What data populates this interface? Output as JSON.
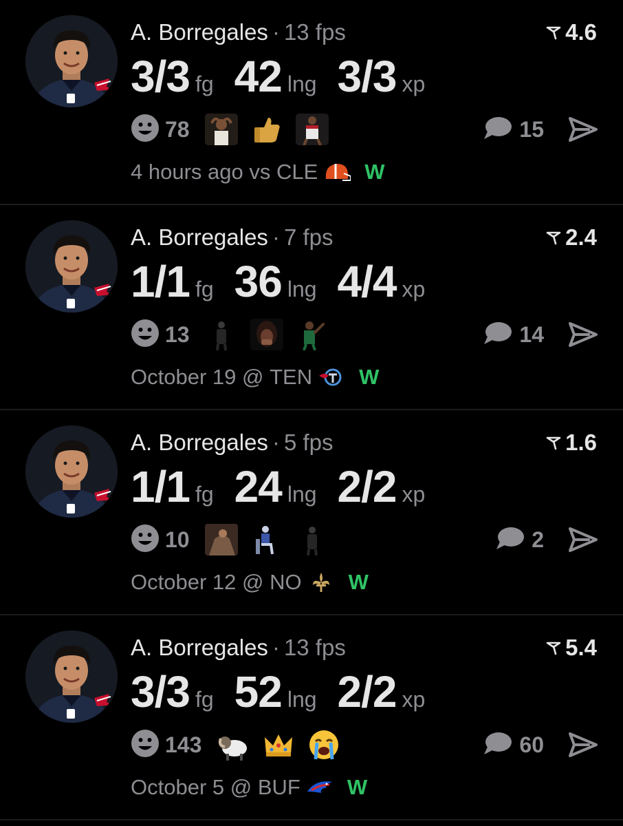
{
  "feed": [
    {
      "player": "A. Borregales",
      "fps": "13 fps",
      "rating": "4.6",
      "stats": [
        {
          "value": "3/3",
          "unit": "fg"
        },
        {
          "value": "42",
          "unit": "lng"
        },
        {
          "value": "3/3",
          "unit": "xp"
        }
      ],
      "reaction_count": "78",
      "reaction_gifs": [
        "hands-on-head-gif",
        "thumbs-up-emoji",
        "basketball-player-gif"
      ],
      "comment_count": "15",
      "time": "4 hours ago",
      "opponent_prefix": "vs",
      "opponent": "CLE",
      "opponent_logo": "browns-helmet-icon",
      "result": "W"
    },
    {
      "player": "A. Borregales",
      "fps": "7 fps",
      "rating": "2.4",
      "stats": [
        {
          "value": "1/1",
          "unit": "fg"
        },
        {
          "value": "36",
          "unit": "lng"
        },
        {
          "value": "4/4",
          "unit": "xp"
        }
      ],
      "reaction_count": "13",
      "reaction_gifs": [
        "standing-man-gif",
        "covering-face-gif",
        "pointing-player-gif"
      ],
      "comment_count": "14",
      "time": "October 19",
      "opponent_prefix": "@",
      "opponent": "TEN",
      "opponent_logo": "titans-logo-icon",
      "result": "W"
    },
    {
      "player": "A. Borregales",
      "fps": "5 fps",
      "rating": "1.6",
      "stats": [
        {
          "value": "1/1",
          "unit": "fg"
        },
        {
          "value": "24",
          "unit": "lng"
        },
        {
          "value": "2/2",
          "unit": "xp"
        }
      ],
      "reaction_count": "10",
      "reaction_gifs": [
        "slouched-person-gif",
        "seated-figure-gif",
        "standing-figure-gif"
      ],
      "comment_count": "2",
      "time": "October 12",
      "opponent_prefix": "@",
      "opponent": "NO",
      "opponent_logo": "fleur-de-lis-icon",
      "result": "W"
    },
    {
      "player": "A. Borregales",
      "fps": "13 fps",
      "rating": "5.4",
      "stats": [
        {
          "value": "3/3",
          "unit": "fg"
        },
        {
          "value": "52",
          "unit": "lng"
        },
        {
          "value": "2/2",
          "unit": "xp"
        }
      ],
      "reaction_count": "143",
      "reaction_gifs": [
        "ram-emoji",
        "crown-emoji",
        "crying-face-emoji"
      ],
      "comment_count": "60",
      "time": "October 5",
      "opponent_prefix": "@",
      "opponent": "BUF",
      "opponent_logo": "bills-logo-icon",
      "result": "W"
    }
  ],
  "colors": {
    "background": "#000000",
    "primary_text": "#e6e6e6",
    "secondary_text": "#8e8e93",
    "win": "#2fc265",
    "divider": "#1c1c1e"
  }
}
